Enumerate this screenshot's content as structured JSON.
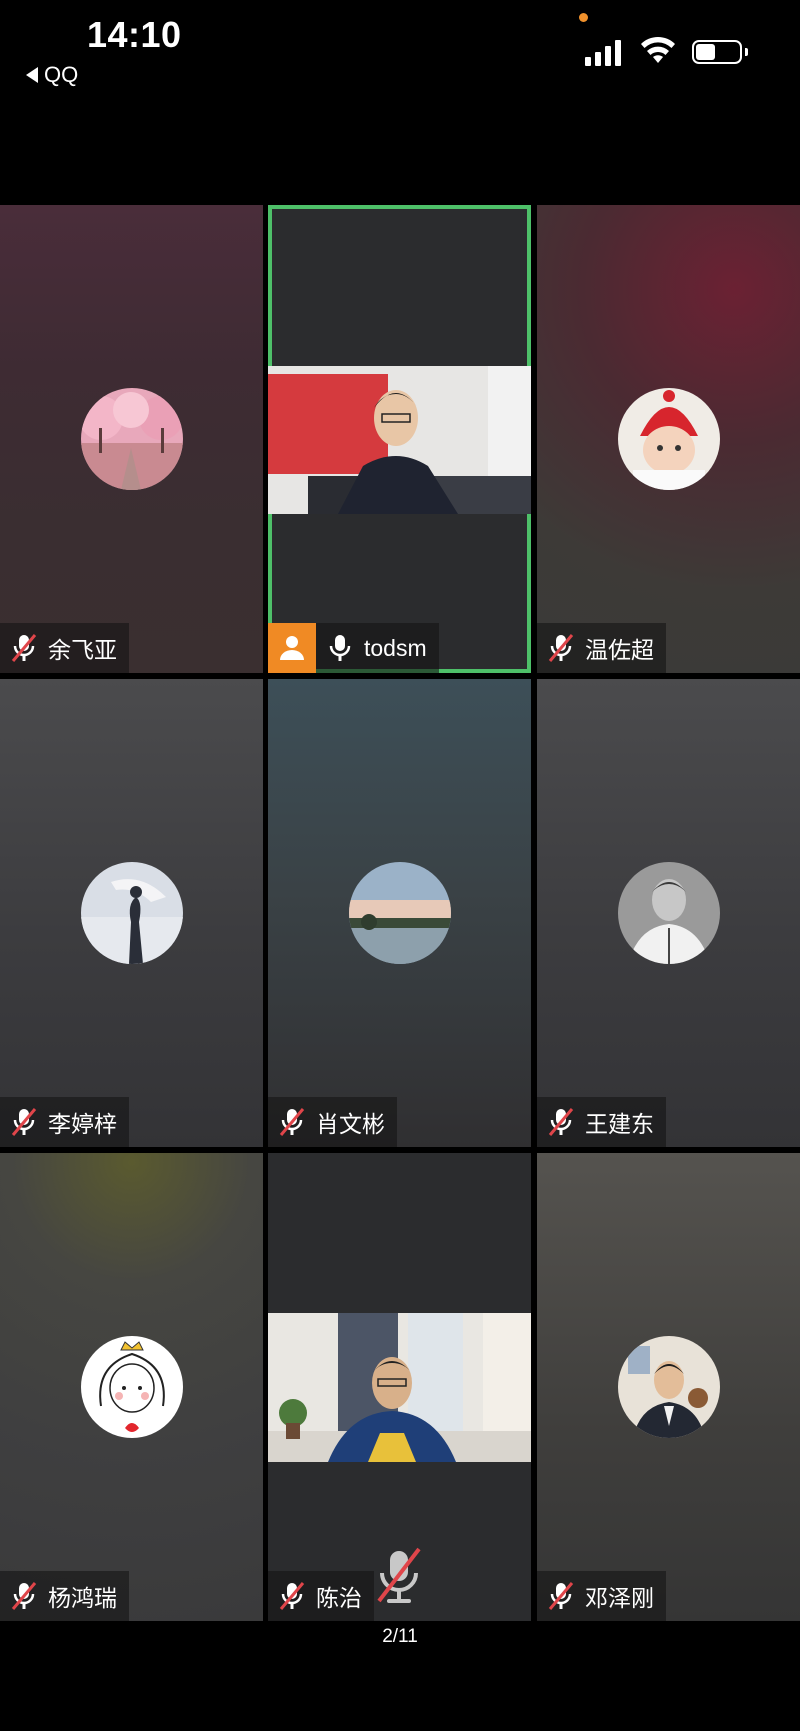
{
  "status_bar": {
    "time": "14:10",
    "back_app": "QQ",
    "signal_bars": 4,
    "battery_level": 0.45
  },
  "participants": [
    {
      "name": "余飞亚",
      "muted": true,
      "avatar_icon": "cherry-blossom-avatar-icon"
    },
    {
      "name": "todsm",
      "muted": false,
      "active_speaker": true,
      "video_on": true
    },
    {
      "name": "温佐超",
      "muted": true,
      "avatar_icon": "baby-avatar-icon"
    },
    {
      "name": "李婷梓",
      "muted": true,
      "avatar_icon": "beach-silhouette-avatar-icon"
    },
    {
      "name": "肖文彬",
      "muted": true,
      "avatar_icon": "sunset-lake-avatar-icon"
    },
    {
      "name": "王建东",
      "muted": true,
      "avatar_icon": "man-portrait-avatar-icon"
    },
    {
      "name": "杨鸿瑞",
      "muted": true,
      "avatar_icon": "cartoon-girl-avatar-icon"
    },
    {
      "name": "陈治",
      "muted": true,
      "video_on": true
    },
    {
      "name": "邓泽刚",
      "muted": true,
      "avatar_icon": "man-suit-avatar-icon"
    }
  ],
  "pagination": {
    "label": "2/11"
  },
  "colors": {
    "active_border": "#4ec069",
    "host_badge": "#f08a24",
    "muted_slash": "#e0454a"
  }
}
